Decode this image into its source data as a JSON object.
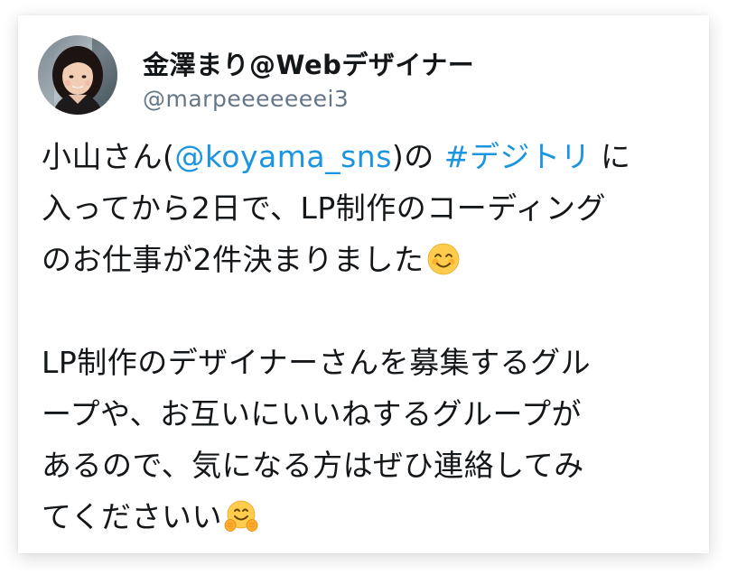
{
  "tweet": {
    "author": {
      "display_name": "金澤まり@Webデザイナー",
      "handle": "@marpeeeeeeei3"
    },
    "body": {
      "line1_a": "小山さん(",
      "line1_mention": "@koyama_sns",
      "line1_b": ")の ",
      "line1_hashtag": "#デジトリ",
      "line1_c": " に",
      "line2": "入ってから2日で、LP制作のコーディング",
      "line3": "のお仕事が2件決まりました",
      "line3_emoji": "smiling-face-icon",
      "line4": "LP制作のデザイナーさんを募集するグル",
      "line5": "ープや、お互いにいいねするグループが",
      "line6": "あるので、気になる方はぜひ連絡してみ",
      "line7": "てくださいい",
      "line7_emoji": "hugging-face-icon"
    },
    "colors": {
      "link": "#1b95e0",
      "text": "#14171a",
      "handle": "#657786"
    }
  }
}
